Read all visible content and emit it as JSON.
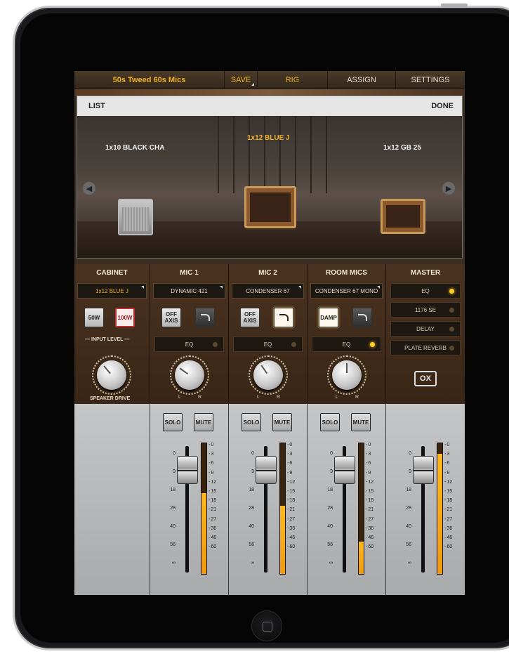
{
  "topbar": {
    "preset": "50s Tweed 60s Mics",
    "save": "SAVE",
    "rig": "RIG",
    "assign": "ASSIGN",
    "settings": "SETTINGS"
  },
  "selector": {
    "list": "LIST",
    "done": "DONE",
    "cabinets": [
      {
        "label": "1x10 BLACK CHA"
      },
      {
        "label": "1x12 BLUE J",
        "active": true
      },
      {
        "label": "1x12 GB 25"
      }
    ],
    "prev_icon": "chevron-left-icon",
    "next_icon": "chevron-right-icon"
  },
  "strips": {
    "cabinet": {
      "title": "CABINET",
      "model": "1x12 BLUE J",
      "btn_50w": "50W",
      "btn_100w": "100W",
      "input_level": "INPUT LEVEL",
      "knob_label": "SPEAKER DRIVE"
    },
    "mic1": {
      "title": "MIC 1",
      "model": "DYNAMIC 421",
      "off_axis": "OFF AXIS",
      "eq": "EQ",
      "eq_on": false,
      "l": "L",
      "r": "R"
    },
    "mic2": {
      "title": "MIC 2",
      "model": "CONDENSER 67",
      "off_axis": "OFF AXIS",
      "eq": "EQ",
      "eq_on": false,
      "l": "L",
      "r": "R"
    },
    "room": {
      "title": "ROOM MICS",
      "model": "CONDENSER 67 MONO",
      "damp": "DAMP",
      "eq": "EQ",
      "eq_on": true,
      "l": "L",
      "r": "R"
    },
    "master": {
      "title": "MASTER",
      "fx": [
        {
          "label": "EQ",
          "on": true
        },
        {
          "label": "1176 SE",
          "on": false
        },
        {
          "label": "DELAY",
          "on": false
        },
        {
          "label": "PLATE REVERB",
          "on": false
        }
      ],
      "ox": "OX"
    }
  },
  "mixer": {
    "solo": "SOLO",
    "mute": "MUTE",
    "fader_scale": [
      "0",
      "9",
      "18",
      "28",
      "40",
      "56",
      "∞"
    ],
    "meter_scale": [
      "0",
      "3",
      "6",
      "9",
      "12",
      "15",
      "18",
      "21",
      "27",
      "36",
      "46",
      "60"
    ],
    "levels": {
      "mic1": 0.62,
      "mic2": 0.52,
      "room": 0.25,
      "master": 0.92
    }
  },
  "colors": {
    "accent": "#f0b020",
    "meter": "#ffb820"
  }
}
